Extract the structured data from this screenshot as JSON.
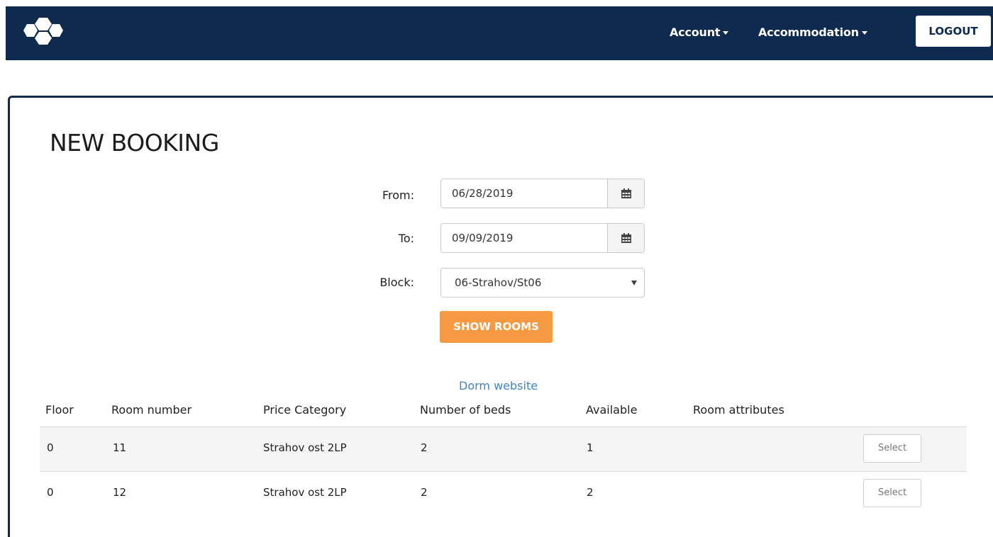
{
  "navbar": {
    "menu": [
      {
        "label": "Account"
      },
      {
        "label": "Accommodation"
      }
    ],
    "logout_label": "LOGOUT"
  },
  "page": {
    "title": "NEW BOOKING"
  },
  "form": {
    "from_label": "From:",
    "from_value": "06/28/2019",
    "to_label": "To:",
    "to_value": "09/09/2019",
    "block_label": "Block:",
    "block_value": "06-Strahov/St06",
    "show_rooms_label": "SHOW ROOMS"
  },
  "dorm_link_label": "Dorm website",
  "table": {
    "headers": [
      "Floor",
      "Room number",
      "Price Category",
      "Number of beds",
      "Available",
      "Room attributes"
    ],
    "rows": [
      {
        "floor": "0",
        "room": "11",
        "category": "Strahov ost 2LP",
        "beds": "2",
        "available": "1",
        "attributes": "",
        "action": "Select"
      },
      {
        "floor": "0",
        "room": "12",
        "category": "Strahov ost 2LP",
        "beds": "2",
        "available": "2",
        "attributes": "",
        "action": "Select"
      }
    ]
  },
  "colors": {
    "navbar": "#0e2a4f",
    "accent": "#f59a42",
    "link": "#3f84c4"
  },
  "icons": [
    "logo-hexagons-icon",
    "caret-down-icon",
    "calendar-icon",
    "chevron-down-icon"
  ]
}
